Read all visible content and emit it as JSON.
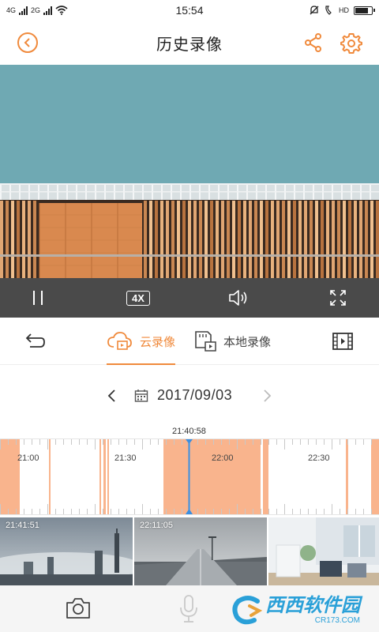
{
  "status_bar": {
    "time": "15:54",
    "net_4g": "4G",
    "net_2g": "2G",
    "hd": "HD",
    "battery_level": 0.85
  },
  "header": {
    "title": "历史录像"
  },
  "controls": {
    "speed_label": "4X"
  },
  "tabs": {
    "cloud_label": "云录像",
    "local_label": "本地录像"
  },
  "date": {
    "value": "2017/09/03"
  },
  "timeline": {
    "cursor_time": "21:40:58",
    "tick_labels": [
      "21:00",
      "21:30",
      "22:00",
      "22:30"
    ]
  },
  "thumbnails": [
    {
      "time": "21:41:51"
    },
    {
      "time": "22:11:05"
    },
    {
      "time": ""
    }
  ],
  "watermark": {
    "main": "西西软件园",
    "sub": "CR173.COM"
  },
  "colors": {
    "accent": "#f08a3c",
    "recorded": "#f9b48d",
    "cursor": "#3b8fe0",
    "control_bar": "#4a4a4a"
  }
}
